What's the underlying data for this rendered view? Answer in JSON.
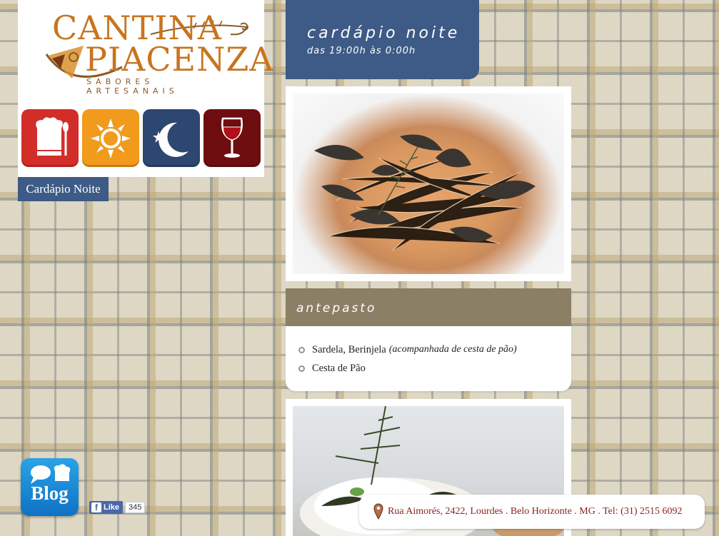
{
  "brand": {
    "line1": "CANTINA",
    "line2": "PIACENZA",
    "tagline": "SABORES ARTESANAIS"
  },
  "nav_icons": [
    {
      "name": "chef-utensils-icon",
      "color": "#d32d2a"
    },
    {
      "name": "sun-icon",
      "color": "#f19a1c"
    },
    {
      "name": "moon-star-icon",
      "color": "#2e4770"
    },
    {
      "name": "wine-glass-icon",
      "color": "#6e0d10"
    }
  ],
  "page_tab": "Cardápio Noite",
  "header": {
    "title": "cardápio noite",
    "subtitle": "das 19:00h às 0:00h"
  },
  "section": {
    "title": "antepasto",
    "items": [
      {
        "name": "Sardela, Berinjela",
        "note": "(acompanhada de cesta de pão)"
      },
      {
        "name": "Cesta de Pão",
        "note": ""
      }
    ]
  },
  "blog": {
    "label": "Blog"
  },
  "facebook": {
    "label": "Like",
    "count": "345"
  },
  "address": "Rua Aimorés, 2422, Lourdes . Belo Horizonte . MG . Tel: (31) 2515 6092",
  "colors": {
    "header_blue": "#3e5a86",
    "section_tan": "#8b7f65",
    "logo_orange": "#c8741e",
    "address_red": "#8b1e1e"
  }
}
